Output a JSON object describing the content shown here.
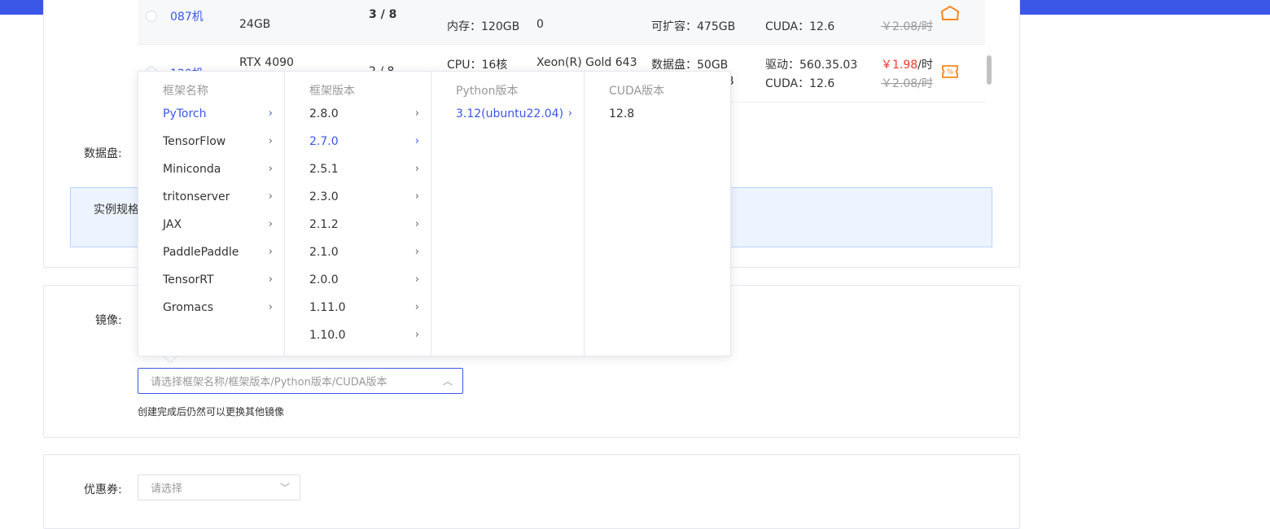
{
  "gpu_table": {
    "rows": [
      {
        "host": "087机",
        "gpu": "24GB",
        "count": "3 / 8",
        "cpu": "内存：120GB",
        "proc": "0",
        "disk": "可扩容：475GB",
        "driver": "CUDA：12.6",
        "price": "",
        "unit": "",
        "old_price": "￥2.08/时"
      },
      {
        "host": "120机",
        "gpu": "RTX 4090",
        "count": "2 / 8",
        "cpu": "CPU：16核",
        "proc": "Xeon(R) Gold 643",
        "disk": "数据盘：50GB",
        "disk2": "B",
        "driver": "驱动：560.35.03",
        "driver2": "CUDA：12.6",
        "price": "￥1.98",
        "unit": "/时",
        "old_price": "￥2.08/时"
      }
    ]
  },
  "form": {
    "data_disk_label": "数据盘:",
    "spec_label": "实例规格",
    "image_label": "镜像:",
    "image_placeholder": "请选择框架名称/框架版本/Python版本/CUDA版本",
    "image_hint": "创建完成后仍然可以更换其他镜像",
    "coupon_label": "优惠券:",
    "coupon_placeholder": "请选择"
  },
  "cascader": {
    "framework_header": "框架名称",
    "version_header": "框架版本",
    "python_header": "Python版本",
    "cuda_header": "CUDA版本",
    "frameworks": [
      "PyTorch",
      "TensorFlow",
      "Miniconda",
      "tritonserver",
      "JAX",
      "PaddlePaddle",
      "TensorRT",
      "Gromacs"
    ],
    "selected_framework": "PyTorch",
    "versions": [
      "2.8.0",
      "2.7.0",
      "2.5.1",
      "2.3.0",
      "2.1.2",
      "2.1.0",
      "2.0.0",
      "1.11.0",
      "1.10.0"
    ],
    "selected_version": "2.7.0",
    "python_versions": [
      "3.12(ubuntu22.04)"
    ],
    "cuda_versions": [
      "12.8"
    ]
  },
  "colors": {
    "primary": "#3a57e8",
    "price_red": "#f2372c",
    "badge_orange": "#f5891f"
  }
}
